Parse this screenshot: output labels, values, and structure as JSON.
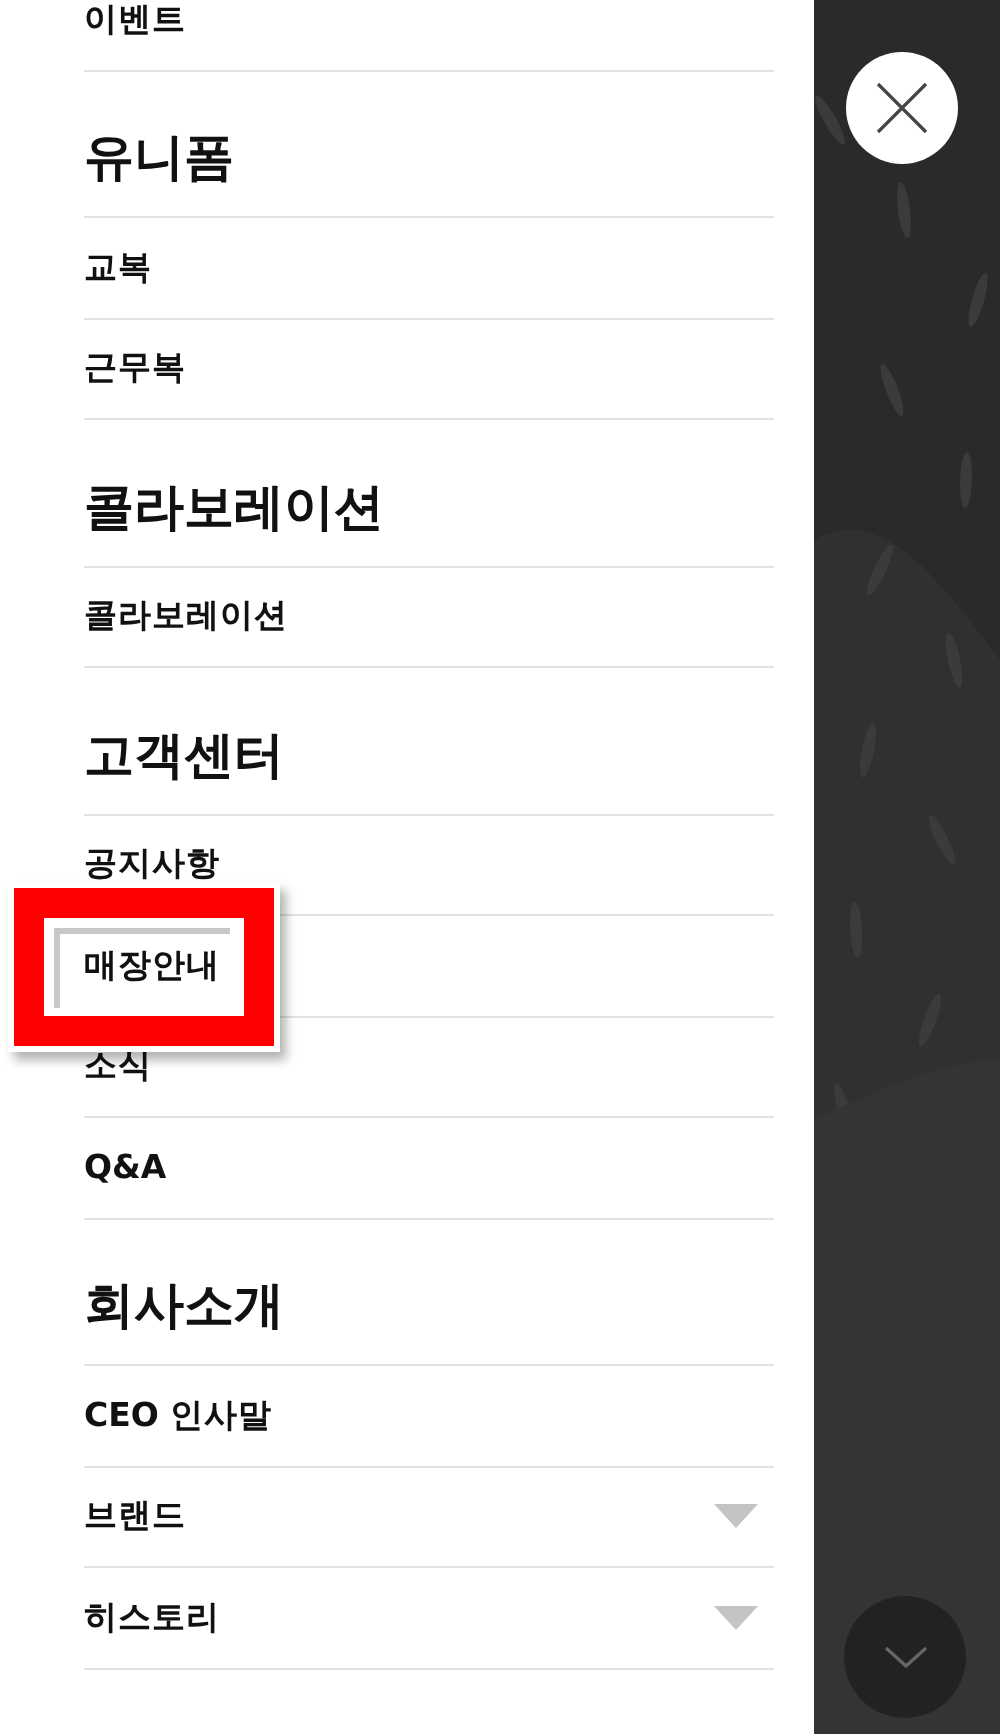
{
  "menu": {
    "items": [
      {
        "kind": "link",
        "label": "이벤트",
        "highlighted": false
      },
      {
        "kind": "heading",
        "label": "유니폼"
      },
      {
        "kind": "link",
        "label": "교복",
        "highlighted": false
      },
      {
        "kind": "link",
        "label": "근무복",
        "highlighted": false
      },
      {
        "kind": "heading",
        "label": "콜라보레이션"
      },
      {
        "kind": "link",
        "label": "콜라보레이션",
        "highlighted": false
      },
      {
        "kind": "heading",
        "label": "고객센터"
      },
      {
        "kind": "link",
        "label": "공지사항",
        "highlighted": false
      },
      {
        "kind": "link",
        "label": "매장안내",
        "highlighted": true
      },
      {
        "kind": "link",
        "label": "소식",
        "highlighted": false
      },
      {
        "kind": "link",
        "label": "Q&A",
        "highlighted": false
      },
      {
        "kind": "heading",
        "label": "회사소개"
      },
      {
        "kind": "link",
        "label": "CEO 인사말",
        "highlighted": false
      },
      {
        "kind": "dropdown",
        "label": "브랜드",
        "highlighted": false
      },
      {
        "kind": "dropdown",
        "label": "히스토리",
        "highlighted": false
      }
    ]
  }
}
